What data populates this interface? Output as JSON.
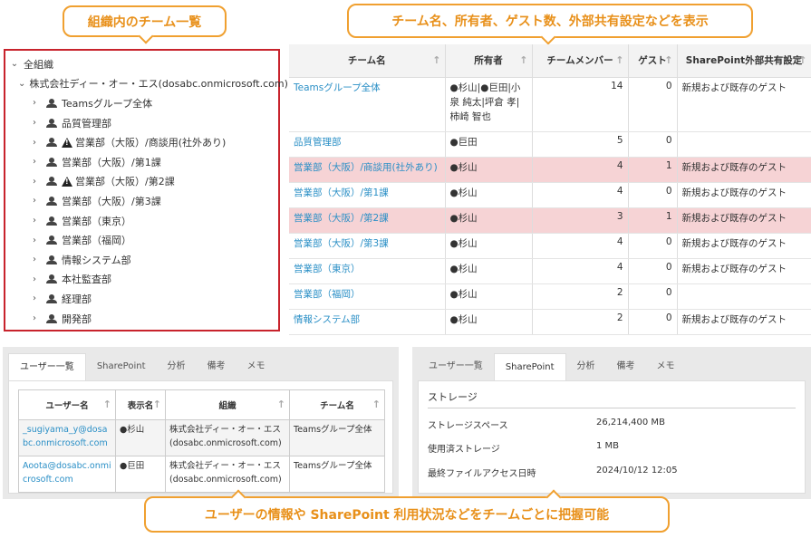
{
  "callouts": {
    "tree": "組織内のチーム一覧",
    "table": "チーム名、所有者、ゲスト数、外部共有設定などを表示",
    "bottom": "ユーザーの情報や SharePoint 利用状況などをチームごとに把握可能"
  },
  "tree": {
    "root": "全組織",
    "company": "株式会社ディー・オー・エス(dosabc.onmicrosoft.com)",
    "items": [
      {
        "label": "Teamsグループ全体",
        "warn": false
      },
      {
        "label": "品質管理部",
        "warn": false
      },
      {
        "label": "営業部（大阪）/商談用(社外あり)",
        "warn": true
      },
      {
        "label": "営業部（大阪）/第1課",
        "warn": false
      },
      {
        "label": "営業部（大阪）/第2課",
        "warn": true
      },
      {
        "label": "営業部（大阪）/第3課",
        "warn": false
      },
      {
        "label": "営業部（東京）",
        "warn": false
      },
      {
        "label": "営業部（福岡）",
        "warn": false
      },
      {
        "label": "情報システム部",
        "warn": false
      },
      {
        "label": "本社監査部",
        "warn": false
      },
      {
        "label": "経理部",
        "warn": false
      },
      {
        "label": "開発部",
        "warn": false
      }
    ]
  },
  "teams": {
    "headers": [
      "チーム名",
      "所有者",
      "チームメンバー",
      "ゲスト",
      "SharePoint外部共有設定"
    ],
    "rows": [
      {
        "name": "Teamsグループ全体",
        "owner": "●杉山|●巨田|小泉 純太|坪倉 孝|柿崎 智也",
        "members": "14",
        "guests": "0",
        "sharing": "新規および既存のゲスト",
        "hl": false
      },
      {
        "name": "品質管理部",
        "owner": "●巨田",
        "members": "5",
        "guests": "0",
        "sharing": "",
        "hl": false
      },
      {
        "name": "営業部（大阪）/商談用(社外あり)",
        "owner": "●杉山",
        "members": "4",
        "guests": "1",
        "sharing": "新規および既存のゲスト",
        "hl": true
      },
      {
        "name": "営業部（大阪）/第1課",
        "owner": "●杉山",
        "members": "4",
        "guests": "0",
        "sharing": "新規および既存のゲスト",
        "hl": false
      },
      {
        "name": "営業部（大阪）/第2課",
        "owner": "●杉山",
        "members": "3",
        "guests": "1",
        "sharing": "新規および既存のゲスト",
        "hl": true
      },
      {
        "name": "営業部（大阪）/第3課",
        "owner": "●杉山",
        "members": "4",
        "guests": "0",
        "sharing": "新規および既存のゲスト",
        "hl": false
      },
      {
        "name": "営業部（東京）",
        "owner": "●杉山",
        "members": "4",
        "guests": "0",
        "sharing": "新規および既存のゲスト",
        "hl": false
      },
      {
        "name": "営業部（福岡）",
        "owner": "●杉山",
        "members": "2",
        "guests": "0",
        "sharing": "",
        "hl": false
      },
      {
        "name": "情報システム部",
        "owner": "●杉山",
        "members": "2",
        "guests": "0",
        "sharing": "新規および既存のゲスト",
        "hl": false
      }
    ]
  },
  "left_panel": {
    "tabs": [
      "ユーザー一覧",
      "SharePoint",
      "分析",
      "備考",
      "メモ"
    ],
    "active_tab": 0,
    "headers": [
      "ユーザー名",
      "表示名",
      "組織",
      "チーム名"
    ],
    "rows": [
      {
        "user": "_sugiyama_y@dosabc.onmicrosoft.com",
        "display": "●杉山",
        "org": "株式会社ディー・オー・エス(dosabc.onmicrosoft.com)",
        "team": "Teamsグループ全体"
      },
      {
        "user": "Aoota@dosabc.onmicrosoft.com",
        "display": "●巨田",
        "org": "株式会社ディー・オー・エス(dosabc.onmicrosoft.com)",
        "team": "Teamsグループ全体"
      }
    ]
  },
  "right_panel": {
    "tabs": [
      "ユーザー一覧",
      "SharePoint",
      "分析",
      "備考",
      "メモ"
    ],
    "active_tab": 1,
    "title": "ストレージ",
    "rows": [
      {
        "key": "ストレージスペース",
        "value": "26,214,400 MB"
      },
      {
        "key": "使用済ストレージ",
        "value": "1 MB"
      },
      {
        "key": "最終ファイルアクセス日時",
        "value": "2024/10/12 12:05"
      }
    ]
  }
}
